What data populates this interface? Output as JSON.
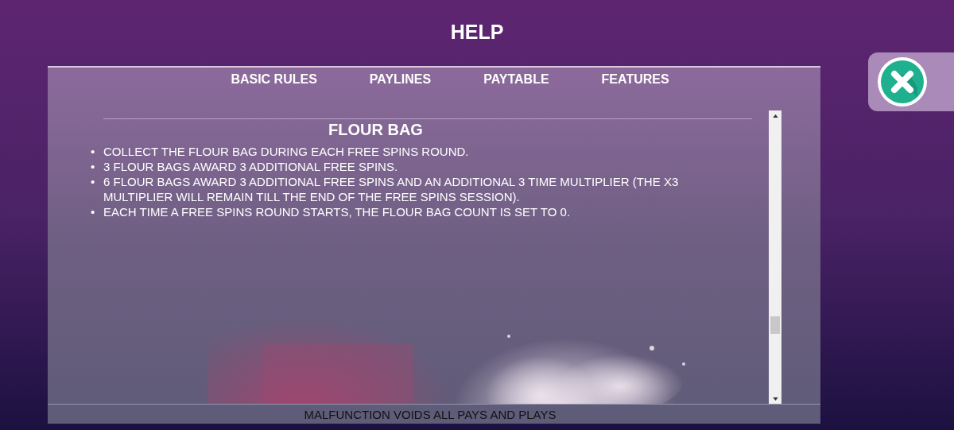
{
  "title": "HELP",
  "tabs": [
    "BASIC RULES",
    "PAYLINES",
    "PAYTABLE",
    "FEATURES"
  ],
  "section": {
    "heading": "FLOUR BAG",
    "items": [
      {
        "bullet": "•",
        "text": "COLLECT THE FLOUR BAG DURING EACH FREE SPINS ROUND."
      },
      {
        "bullet": "•",
        "text": "3 FLOUR BAGS AWARD 3 ADDITIONAL FREE SPINS."
      },
      {
        "bullet": "•",
        "text": "6 FLOUR BAGS AWARD 3 ADDITIONAL FREE SPINS AND AN ADDITIONAL 3 TIME MULTIPLIER (THE X3 MULTIPLIER WILL REMAIN TILL THE END OF THE FREE SPINS SESSION)."
      },
      {
        "bullet": "•",
        "text": "EACH TIME A FREE SPINS ROUND STARTS, THE FLOUR BAG COUNT IS SET TO 0."
      }
    ]
  },
  "footer": "MALFUNCTION VOIDS ALL PAYS AND PLAYS"
}
